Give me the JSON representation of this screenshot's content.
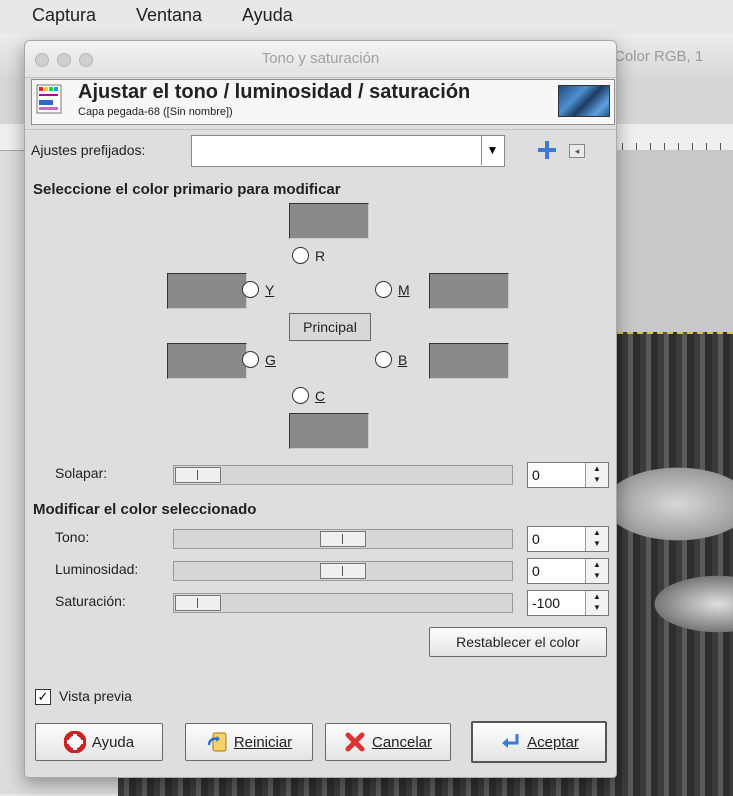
{
  "menubar": {
    "items": [
      "Captura",
      "Ventana",
      "Ayuda"
    ]
  },
  "background_window": {
    "title_fragment": "Color RGB, 1"
  },
  "dialog": {
    "window_title": "Tono y saturación",
    "header_title": "Ajustar el tono / luminosidad / saturación",
    "header_subtitle": "Capa pegada-68 ([Sin nombre])",
    "presets_label": "Ajustes prefijados:",
    "presets_value": "",
    "section_primary": "Seleccione el color primario para modificar",
    "radios": {
      "r": "R",
      "y": "Y",
      "m": "M",
      "g": "G",
      "b": "B",
      "c": "C"
    },
    "principal_label": "Principal",
    "overlap_label": "Solapar:",
    "overlap_value": "0",
    "section_modify": "Modificar el color seleccionado",
    "hue_label": "Tono:",
    "hue_value": "0",
    "lightness_label": "Luminosidad:",
    "lightness_value": "0",
    "saturation_label": "Saturación:",
    "saturation_value": "-100",
    "reset_color_label": "Restablecer el color",
    "preview_label": "Vista previa",
    "preview_checked": true,
    "buttons": {
      "help": "Ayuda",
      "reset": "Reiniciar",
      "cancel": "Cancelar",
      "ok": "Aceptar"
    }
  },
  "colors": {
    "swatch": "#8a8a8a",
    "dialog_bg": "#dedede",
    "add_icon": "#3a7bd5"
  },
  "icons": [
    "hue-saturation-icon",
    "add-preset-icon",
    "preset-menu-icon",
    "help-lifebuoy-icon",
    "reset-icon",
    "cancel-x-icon",
    "ok-return-icon"
  ]
}
